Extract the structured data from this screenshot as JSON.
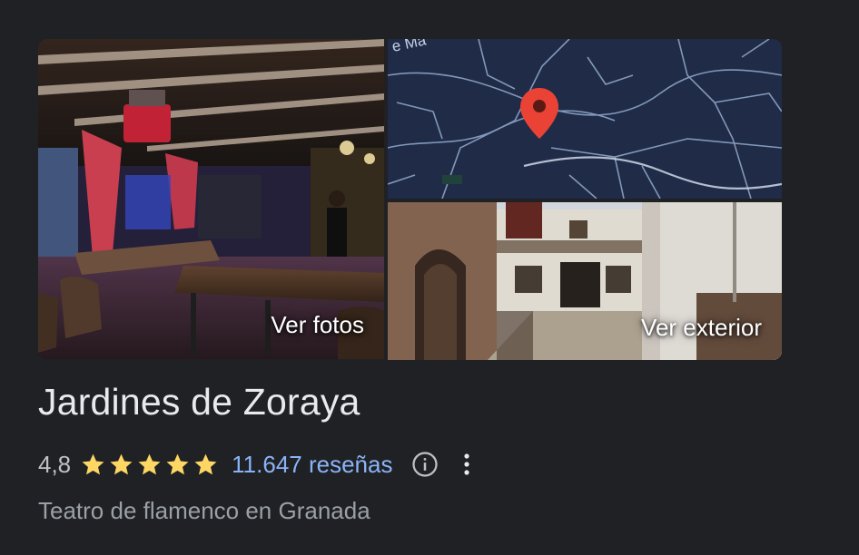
{
  "place": {
    "name": "Jardines de Zoraya",
    "rating": "4,8",
    "rating_stars": 5,
    "reviews_label": "11.647 reseñas",
    "category": "Teatro de flamenco en Granada"
  },
  "media": {
    "photos_label": "Ver fotos",
    "exterior_label": "Ver exterior",
    "map_street_text": "e Ma"
  },
  "icons": {
    "info": "info-circle-icon",
    "more": "more-vert-icon",
    "star": "star-icon",
    "pin": "map-pin-icon"
  },
  "colors": {
    "background": "#202124",
    "link": "#8ab4f8",
    "star": "#fdd663",
    "title": "#e8eaed",
    "muted": "#9aa0a6",
    "map_bg": "#1f2b47",
    "pin": "#ea4335"
  }
}
